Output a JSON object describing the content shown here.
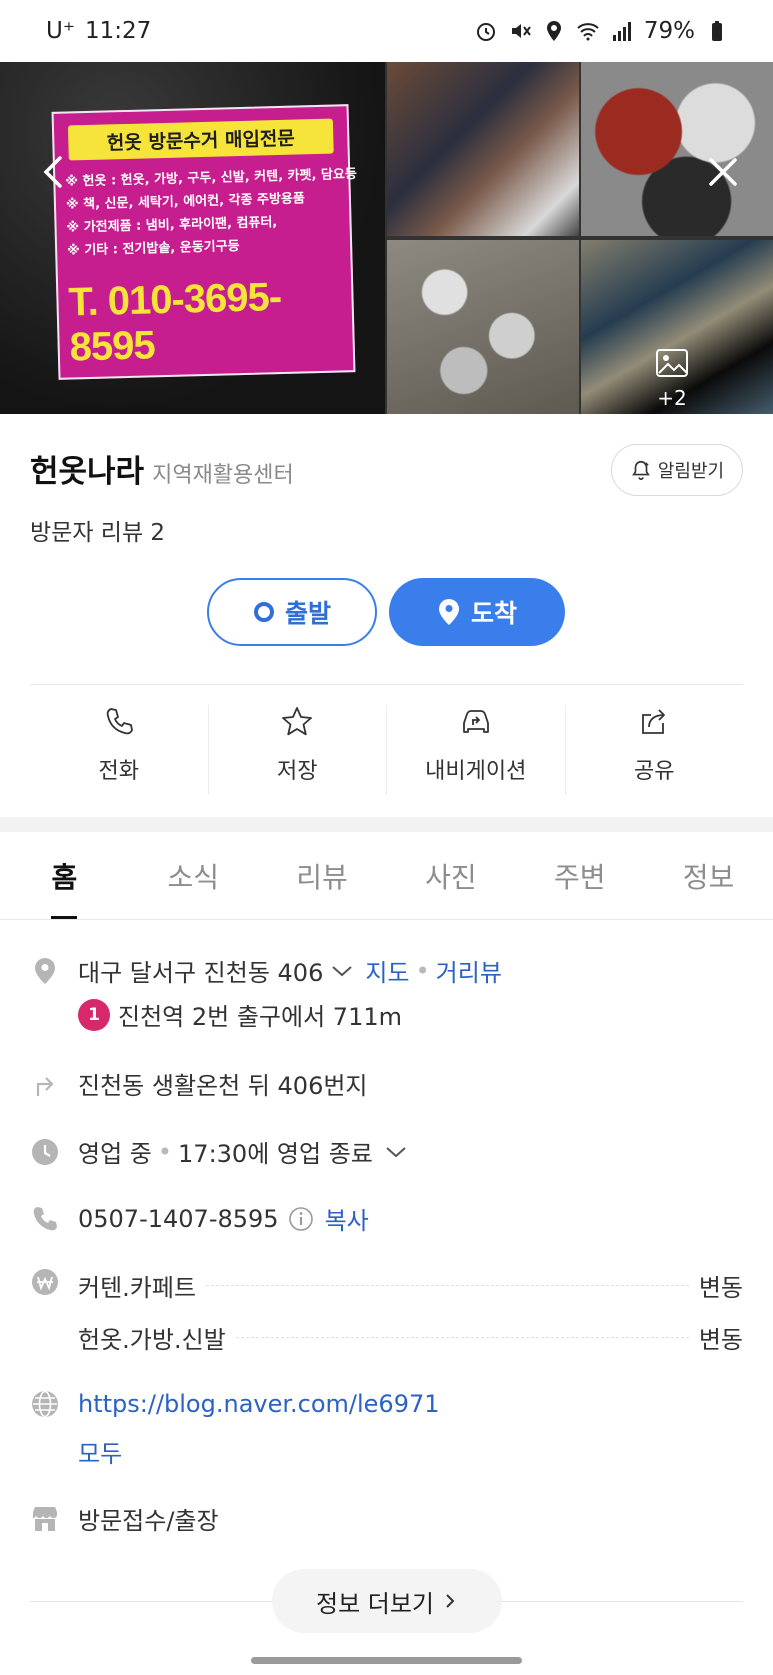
{
  "status_bar": {
    "carrier": "U⁺",
    "time": "11:27",
    "battery": "79%"
  },
  "gallery": {
    "flyer": {
      "title": "헌옷 방문수거 매입전문",
      "lines": [
        "※ 헌옷 : 헌옷, 가방, 구두, 신발, 커텐, 카펫, 담요등",
        "※ 책, 신문, 세탁기, 에어컨, 각종 주방용품",
        "※ 가전제품 : 냄비, 후라이팬, 컴퓨터,",
        "※ 기타 : 전기밥솥, 운동기구등"
      ],
      "phone": "T. 010-3695-8595"
    },
    "more_count": "+2"
  },
  "place": {
    "name": "헌옷나라",
    "category": "지역재활용센터",
    "review_count": "방문자 리뷰 2"
  },
  "alarm_label": "알림받기",
  "route": {
    "start_label": "출발",
    "end_label": "도착"
  },
  "actions": [
    {
      "label": "전화",
      "icon": "phone-icon"
    },
    {
      "label": "저장",
      "icon": "star-icon"
    },
    {
      "label": "내비게이션",
      "icon": "car-icon"
    },
    {
      "label": "공유",
      "icon": "share-icon"
    }
  ],
  "tabs": [
    "홈",
    "소식",
    "리뷰",
    "사진",
    "주변",
    "정보"
  ],
  "info": {
    "address": "대구 달서구 진천동 406",
    "map_link": "지도",
    "street_view": "거리뷰",
    "subway_line": "1",
    "subway_text": "진천역 2번 출구에서 711m",
    "directions": "진천동 생활온천 뒤 406번지",
    "hours_status": "영업 중",
    "hours_detail": "17:30에 영업 종료",
    "phone": "0507-1407-8595",
    "copy_label": "복사",
    "prices": [
      {
        "item": "커텐.카페트",
        "price": "변동"
      },
      {
        "item": "헌옷.가방.신발",
        "price": "변동"
      }
    ],
    "website_line1": "https://blog.naver.com/le6971",
    "website_line2": "모두",
    "service": "방문접수/출장"
  },
  "more_info_label": "정보 더보기",
  "colors": {
    "accent_blue": "#3a7eeb",
    "link_blue": "#2b63c4",
    "subway_line1": "#d6286a"
  }
}
